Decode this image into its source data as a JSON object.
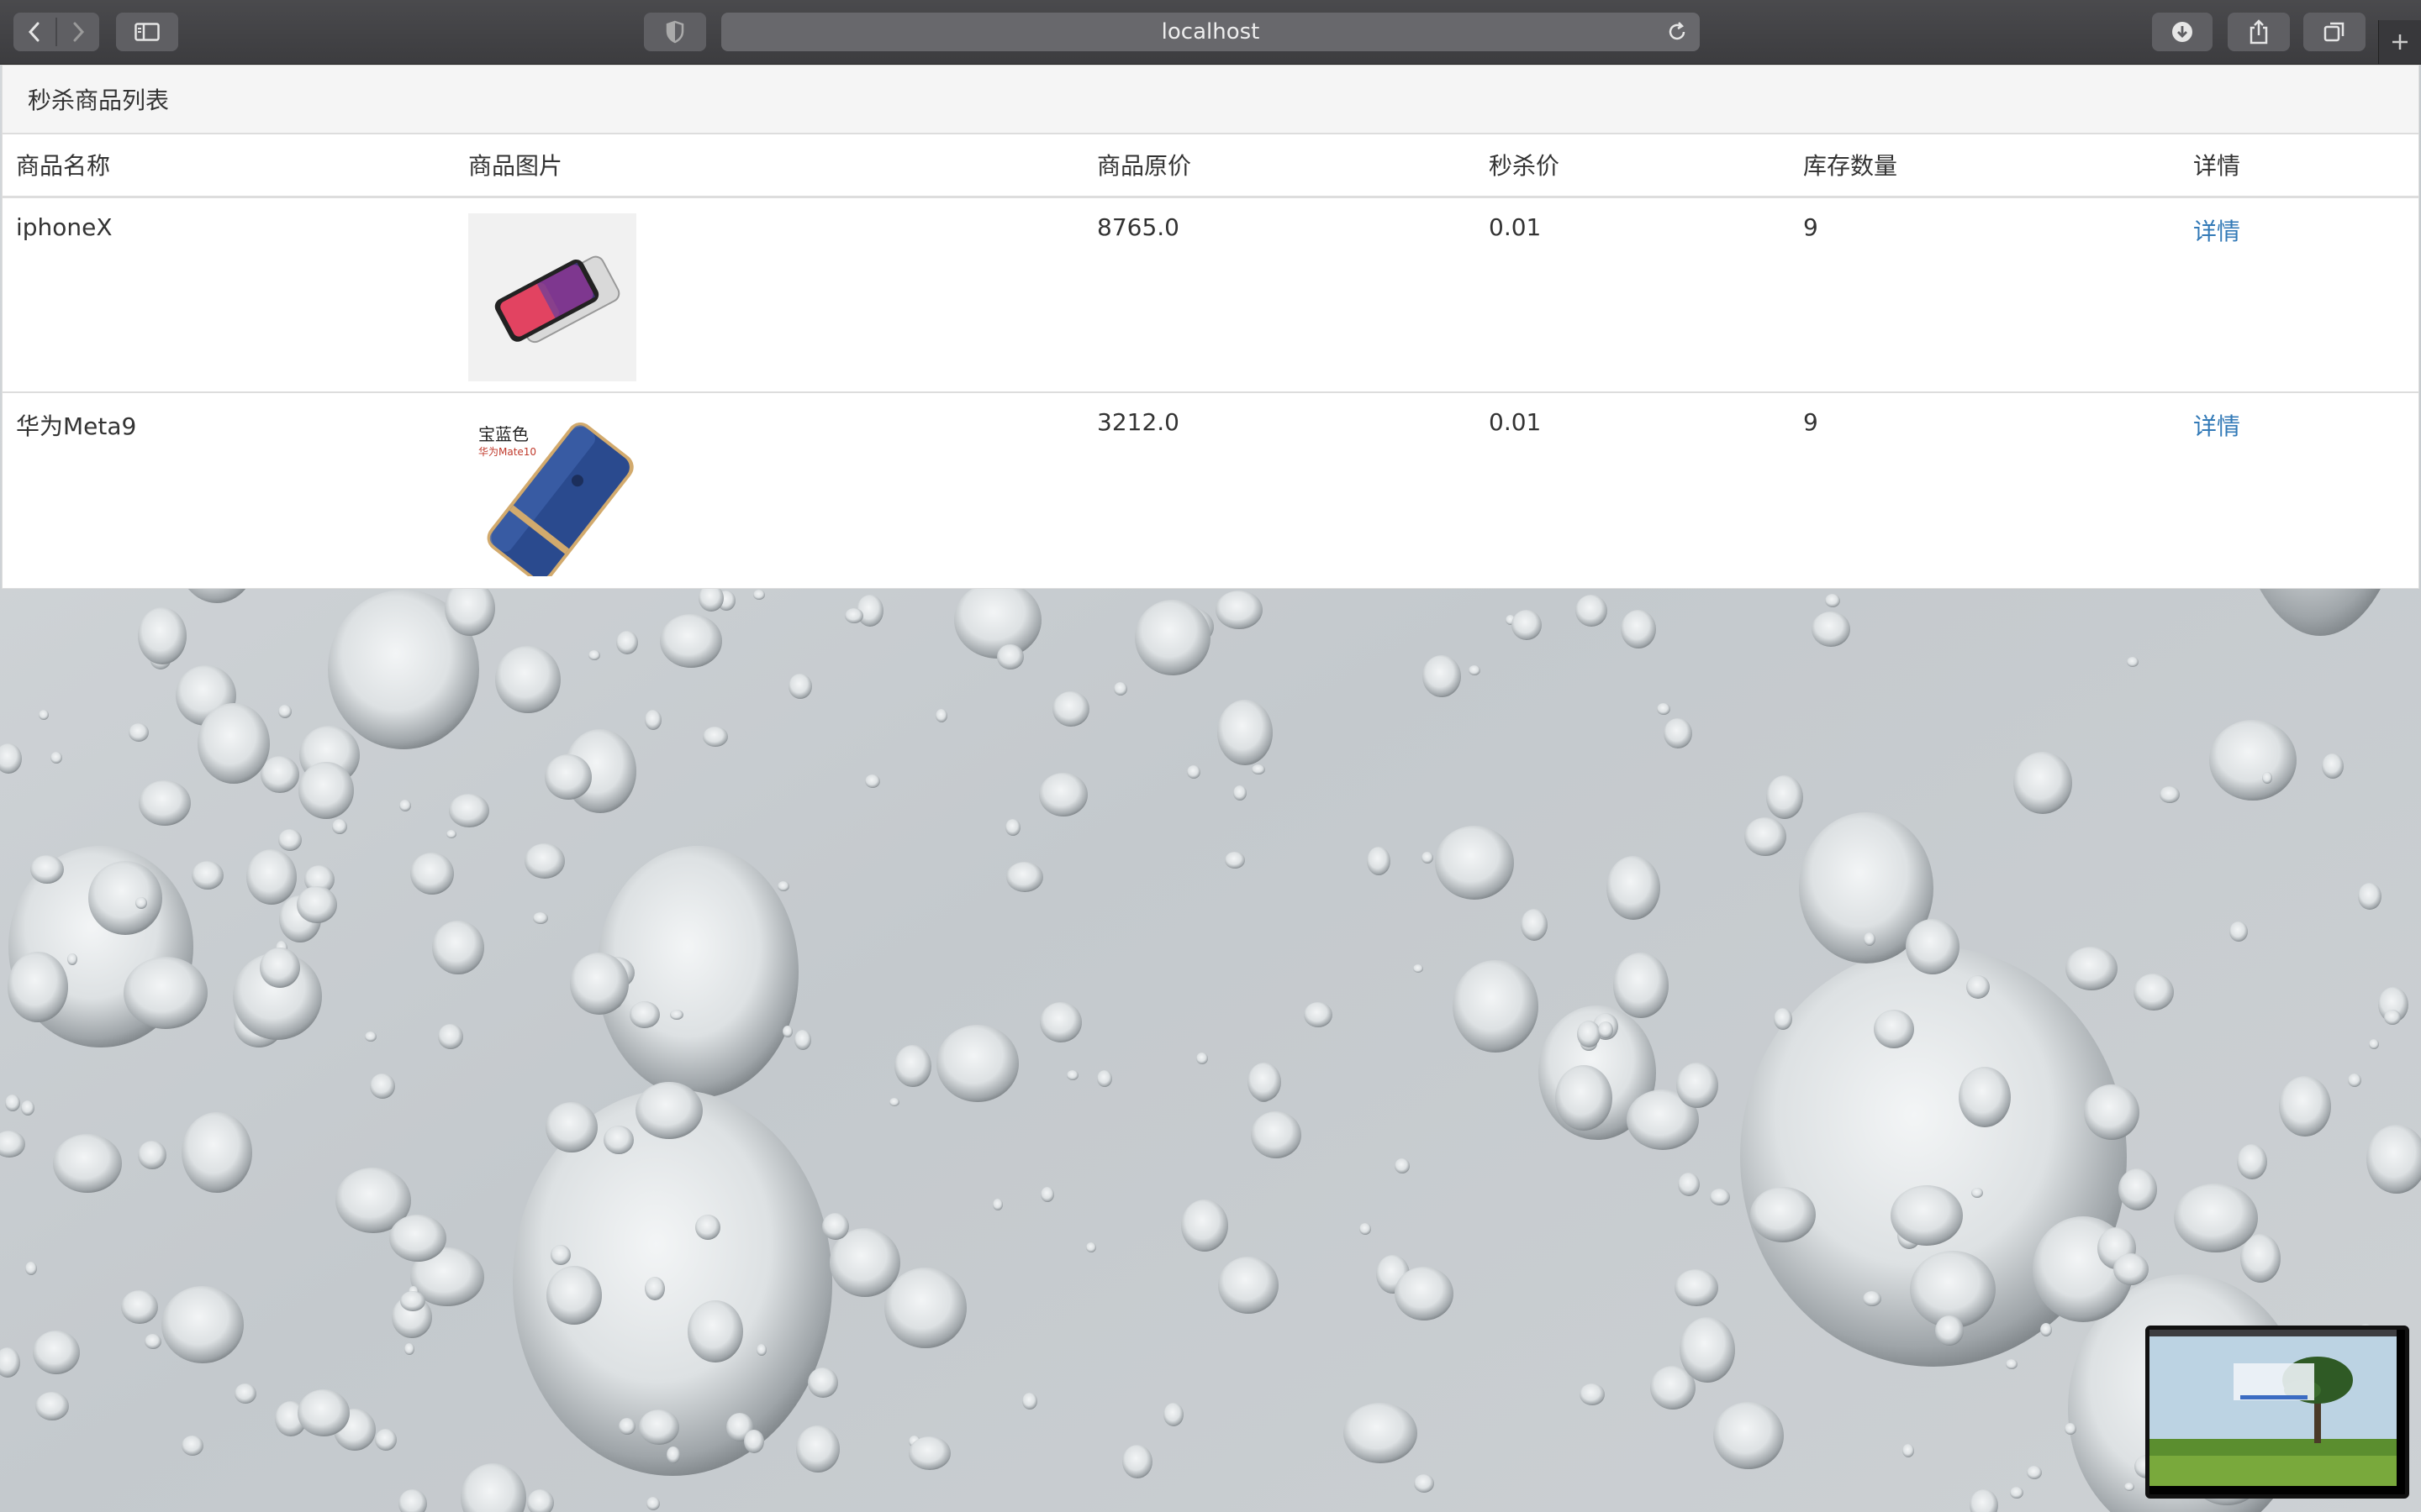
{
  "browser": {
    "url": "localhost",
    "icons": [
      "back-icon",
      "forward-icon",
      "sidebar-icon",
      "shield-icon",
      "reload-icon",
      "download-icon",
      "share-icon",
      "tabs-icon",
      "plus-icon"
    ]
  },
  "page": {
    "panel_title": "秒杀商品列表",
    "columns": [
      "商品名称",
      "商品图片",
      "商品原价",
      "秒杀价",
      "库存数量",
      "详情"
    ],
    "rows": [
      {
        "name": "iphoneX",
        "price": "8765.0",
        "seckill_price": "0.01",
        "stock": "9",
        "detail": "详情"
      },
      {
        "name": "华为Meta9",
        "price": "3212.0",
        "seckill_price": "0.01",
        "stock": "9",
        "detail": "详情"
      }
    ],
    "huawei_img_title": "宝蓝色",
    "huawei_img_sub": "华为Mate10"
  },
  "colors": {
    "link": "#337ab7",
    "heading_bg": "#f5f5f5",
    "chrome": "#3c3c3f"
  }
}
